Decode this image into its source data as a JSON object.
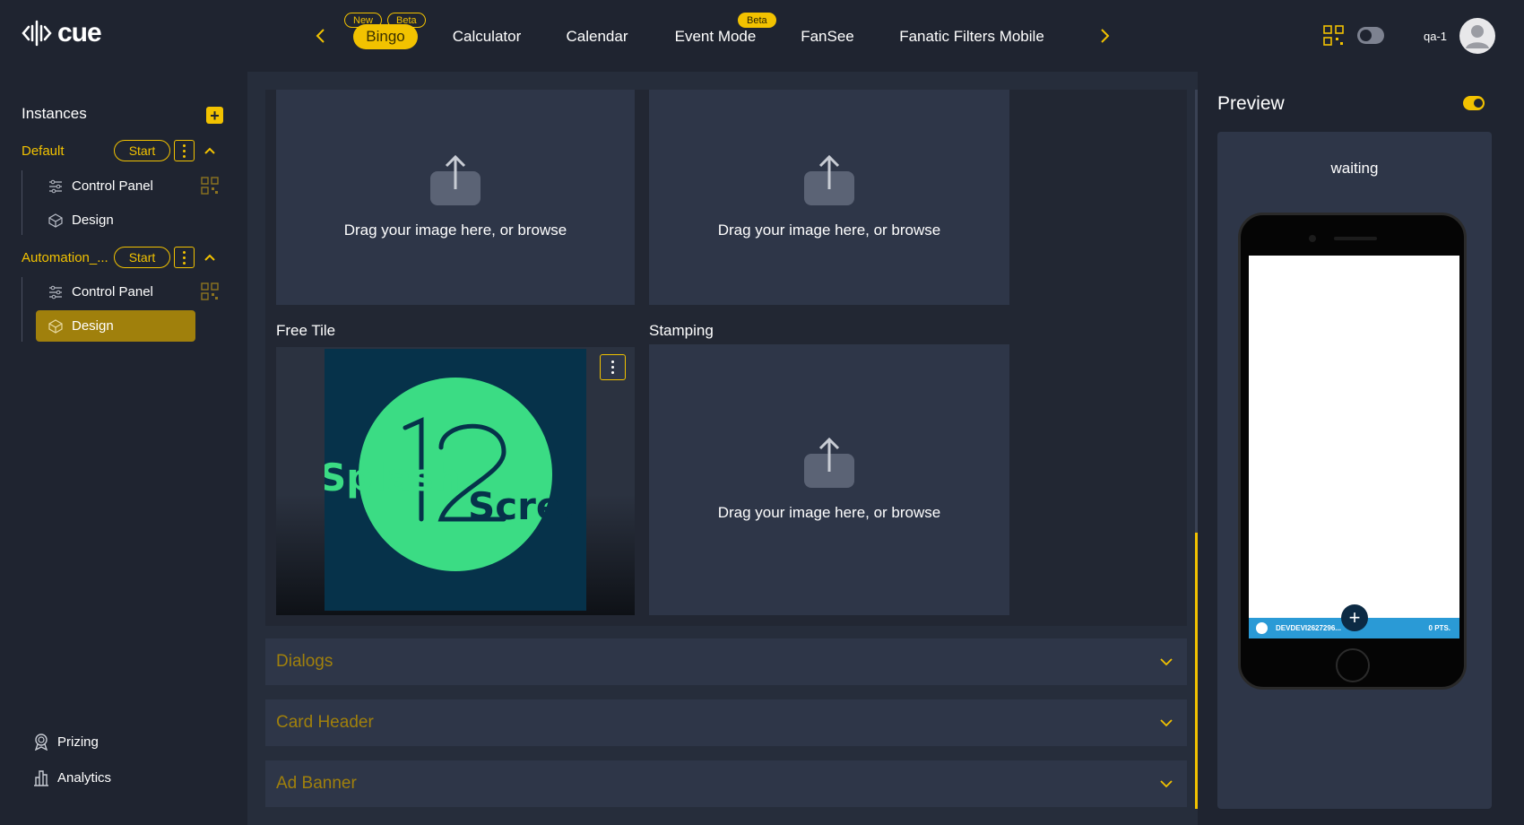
{
  "app": {
    "logo_text": "cue"
  },
  "nav": {
    "tabs": [
      {
        "label": "Bingo",
        "active": true
      },
      {
        "label": "Calculator"
      },
      {
        "label": "Calendar"
      },
      {
        "label": "Event Mode"
      },
      {
        "label": "FanSee"
      },
      {
        "label": "Fanatic Filters Mobile"
      }
    ],
    "badges": {
      "bingo_new": "New",
      "bingo_beta": "Beta",
      "event_beta": "Beta"
    }
  },
  "user": {
    "name": "qa-1"
  },
  "sidebar": {
    "title": "Instances",
    "instances": [
      {
        "name": "Default",
        "start": "Start",
        "items": [
          "Control Panel",
          "Design"
        ]
      },
      {
        "name": "Automation_...",
        "start": "Start",
        "items": [
          "Control Panel",
          "Design"
        ]
      }
    ],
    "bottom": {
      "prizing": "Prizing",
      "analytics": "Analytics"
    }
  },
  "main": {
    "dropzone_text": "Drag your image here, or browse",
    "free_tile_label": "Free Tile",
    "stamping_label": "Stamping",
    "splash_text_left": "Splash",
    "splash_text_right": "Screen",
    "accordions": [
      "Dialogs",
      "Card Header",
      "Ad Banner"
    ]
  },
  "preview": {
    "title": "Preview",
    "status": "waiting",
    "device_id": "DEVDEVI2627296...",
    "points": "0 PTS."
  },
  "colors": {
    "accent": "#f2c200",
    "bg": "#1f2430",
    "panel": "#2e3648"
  }
}
